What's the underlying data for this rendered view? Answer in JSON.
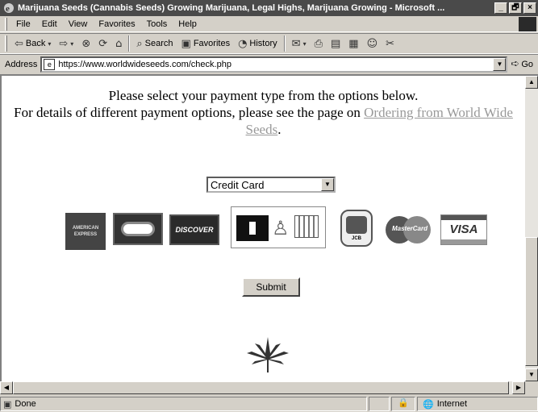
{
  "window": {
    "title": "Marijuana Seeds (Cannabis Seeds) Growing Marijuana, Legal Highs, Marijuana Growing - Microsoft ...",
    "controls": [
      "_",
      "🗗",
      "×"
    ]
  },
  "menu": {
    "items": [
      "File",
      "Edit",
      "View",
      "Favorites",
      "Tools",
      "Help"
    ]
  },
  "toolbar": {
    "back_label": "Back",
    "search_label": "Search",
    "favorites_label": "Favorites",
    "history_label": "History"
  },
  "address": {
    "label": "Address",
    "url": "https://www.worldwideseeds.com/check.php",
    "go_label": "Go"
  },
  "content": {
    "line1": "Please select your payment type from the options below.",
    "line2": "For details of different payment options, please see the page on ",
    "link_text": "Ordering from World Wide Seeds",
    "line_end": ".",
    "payment_select_value": "Credit Card",
    "submit_label": "Submit",
    "cards": {
      "amex_text_1": "AMERICAN",
      "amex_text_2": "EXPRESS",
      "discover_text": "DISCOVER",
      "jcb_text": "JCB",
      "mastercard_text": "MasterCard",
      "visa_text": "VISA"
    }
  },
  "status": {
    "text": "Done",
    "zone": "Internet"
  }
}
